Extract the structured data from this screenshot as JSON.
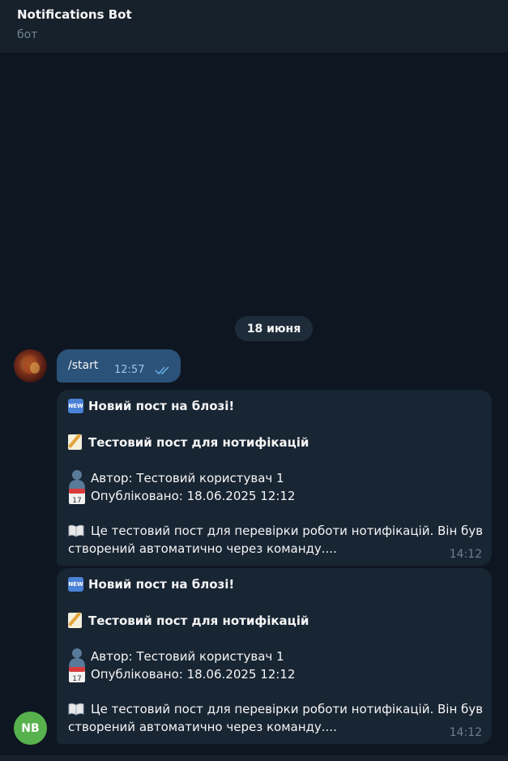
{
  "header": {
    "title": "Notifications Bot",
    "subtitle": "бот"
  },
  "date_separator": "18 июня",
  "outgoing": {
    "text": "/start",
    "time": "12:57"
  },
  "posts": [
    {
      "new_badge": "NEW",
      "heading": "Новий пост на блозі!",
      "title": "Тестовий пост для нотифікацій",
      "author": "Автор: Тестовий користувач 1",
      "published": "Опубліковано: 18.06.2025 12:12",
      "excerpt_line1": "Це тестовий пост для перевірки роботи нотифікацій. Він був",
      "excerpt_line2": "створений автоматично через команду....",
      "time": "14:12"
    },
    {
      "new_badge": "NEW",
      "heading": "Новий пост на блозі!",
      "title": "Тестовий пост для нотифікацій",
      "author": "Автор: Тестовий користувач 1",
      "published": "Опубліковано: 18.06.2025 12:12",
      "excerpt_line1": "Це тестовий пост для перевірки роботи нотифікацій. Він був",
      "excerpt_line2": "створений автоматично через команду....",
      "time": "14:12"
    }
  ],
  "bot_avatar": {
    "initials": "NB",
    "color": "#57b14d"
  },
  "colors": {
    "outgoing_bubble": "#2b5278",
    "incoming_bubble": "#182533",
    "background": "#0e1621"
  },
  "icons": [
    "new-button-icon",
    "memo-icon",
    "person-silhouette-icon",
    "calendar-icon",
    "open-book-icon",
    "double-check-icon"
  ]
}
